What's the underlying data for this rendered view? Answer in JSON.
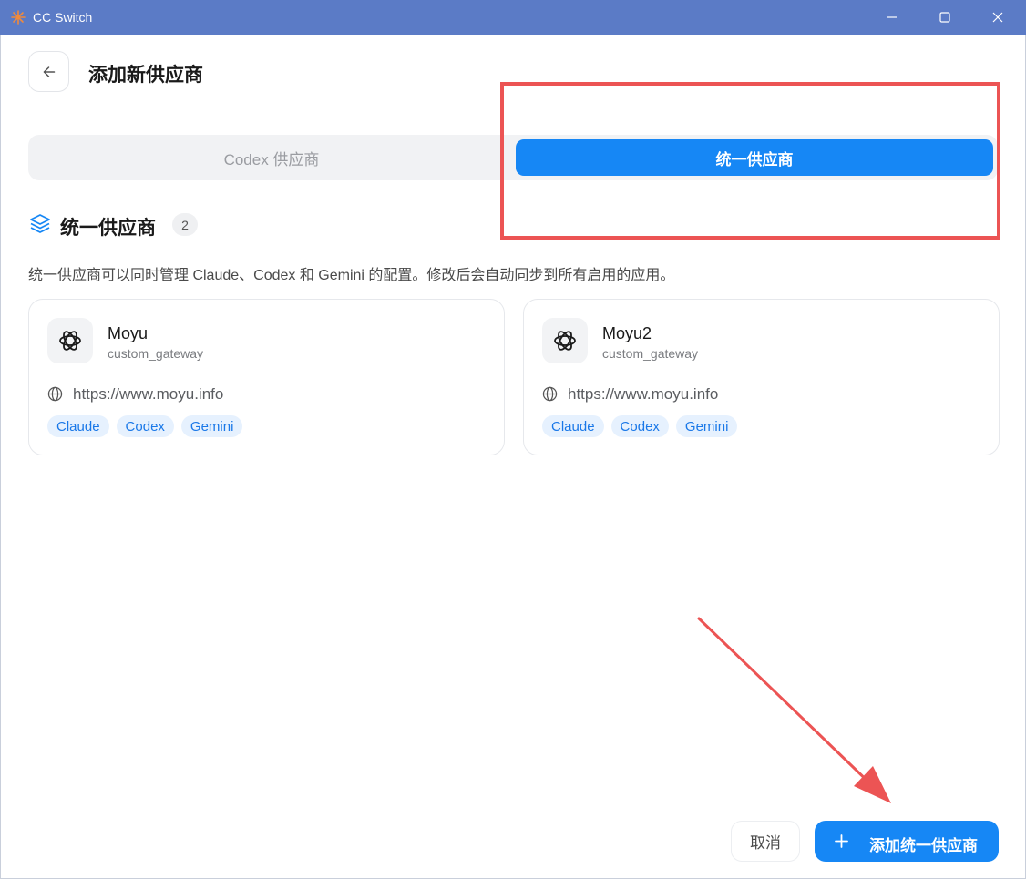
{
  "window": {
    "title": "CC Switch",
    "logo_icon": "sunburst-logo-icon",
    "controls": [
      "minimize-icon",
      "maximize-icon",
      "close-icon"
    ]
  },
  "header": {
    "back_icon": "arrow-left-icon",
    "title": "添加新供应商"
  },
  "tabs": [
    {
      "label": "Codex 供应商",
      "active": false
    },
    {
      "label": "统一供应商",
      "active": true
    }
  ],
  "section": {
    "icon": "layers-icon",
    "title": "统一供应商",
    "count": "2",
    "description": "统一供应商可以同时管理 Claude、Codex 和 Gemini 的配置。修改后会自动同步到所有启用的应用。"
  },
  "providers": [
    {
      "name": "Moyu",
      "type": "custom_gateway",
      "icon": "openai-logo-icon",
      "url": "https://www.moyu.info",
      "tags": [
        "Claude",
        "Codex",
        "Gemini"
      ]
    },
    {
      "name": "Moyu2",
      "type": "custom_gateway",
      "icon": "openai-logo-icon",
      "url": "https://www.moyu.info",
      "tags": [
        "Claude",
        "Codex",
        "Gemini"
      ]
    }
  ],
  "footer": {
    "cancel_label": "取消",
    "add_label": "添加统一供应商",
    "add_icon": "plus-icon"
  },
  "colors": {
    "titlebar": "#5b7bc6",
    "accent": "#1687f5",
    "annotation": "#ec5454",
    "tag_bg": "#e6f1fe",
    "tag_text": "#1a78e8"
  }
}
